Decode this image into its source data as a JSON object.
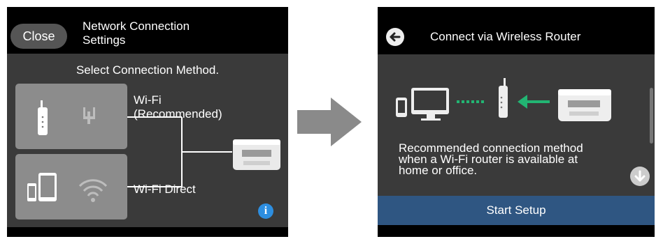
{
  "left_screen": {
    "close_label": "Close",
    "title_line1": "Network Connection",
    "title_line2": "Settings",
    "prompt": "Select Connection Method.",
    "options": [
      {
        "label_line1": "Wi-Fi",
        "label_line2": "(Recommended)",
        "icons": [
          "router-icon",
          "ethernet-icon"
        ]
      },
      {
        "label_line1": "Wi-Fi Direct",
        "label_line2": "",
        "icons": [
          "smartphone-icon",
          "tablet-icon",
          "wifi-icon"
        ]
      }
    ],
    "info_label": "i"
  },
  "right_screen": {
    "title": "Connect via Wireless Router",
    "description_line1": "Recommended connection method",
    "description_line2": "when a Wi-Fi router is available at",
    "description_line3": "home or office.",
    "setup_label": "Start Setup",
    "icons": [
      "smartphone-icon",
      "monitor-icon",
      "router-icon",
      "printer-icon"
    ]
  },
  "colors": {
    "panel_bg": "#3a3a3a",
    "card_bg": "#8c8c8c",
    "accent_green": "#22b573",
    "info_blue": "#2d8ee0",
    "setup_blue": "#2f5682"
  }
}
